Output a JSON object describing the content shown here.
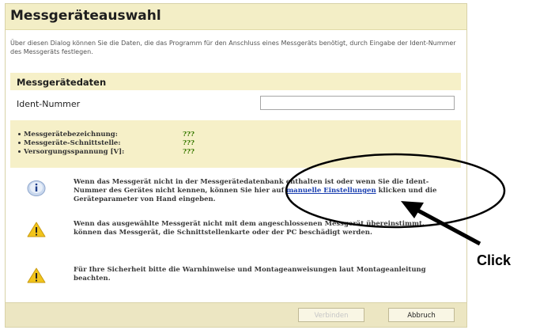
{
  "dialog": {
    "title": "Messgeräteauswahl",
    "intro": "Über diesen Dialog können Sie die Daten, die das Programm für den Anschluss eines Messgeräts benötigt, durch Eingabe der Ident-Nummer des Messgeräts festlegen."
  },
  "section": {
    "title": "Messgerätedaten"
  },
  "ident": {
    "label": "Ident-Nummer",
    "value": ""
  },
  "properties": [
    {
      "label": "Messgerätebezeichnung:",
      "value": "???"
    },
    {
      "label": "Messgeräte-Schnittstelle:",
      "value": "???"
    },
    {
      "label": "Versorgungsspannung [V]:",
      "value": "???"
    }
  ],
  "messages": {
    "info_before": "Wenn das Messgerät nicht in der Messgerätedatenbank enthalten ist oder wenn Sie die Ident-Nummer des Gerätes nicht kennen, können Sie hier auf ",
    "info_link": "manuelle Einstellungen",
    "info_after": " klicken und die Geräteparameter von Hand eingeben.",
    "warning1": "Wenn das ausgewählte Messgerät nicht mit dem angeschlossenen Messgerät übereinstimmt, können das Messgerät, die Schnittstellenkarte oder der PC beschädigt werden.",
    "warning2": "Für Ihre Sicherheit bitte die Warnhinweise und Montageanweisungen laut Montageanleitung beachten."
  },
  "icons": {
    "info": "info-icon",
    "warning": "warning-icon"
  },
  "buttons": {
    "connect": "Verbinden",
    "cancel": "Abbruch"
  },
  "annotation": {
    "label": "Click"
  },
  "colors": {
    "header_bg": "#f3eec6",
    "section_bg": "#f6f0c8",
    "link": "#1a3fb0",
    "value": "#3a7a00"
  }
}
